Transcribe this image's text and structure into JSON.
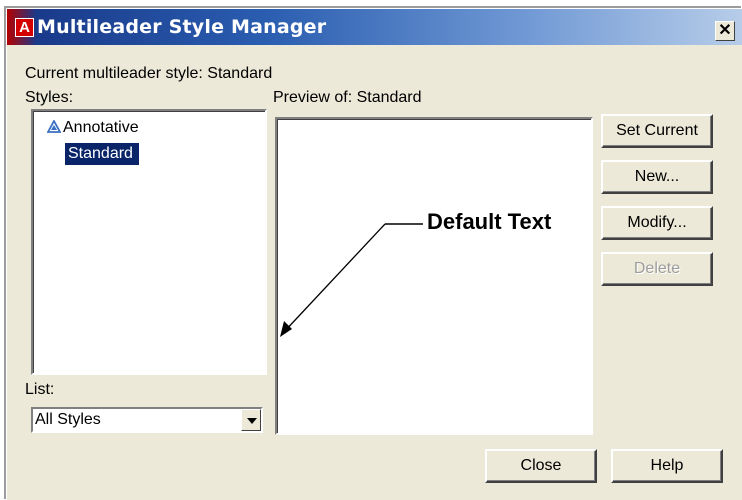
{
  "window": {
    "title": "Multileader Style Manager",
    "app_icon_letter": "A",
    "close_glyph": "✕"
  },
  "current_style": {
    "text": "Current multileader style: Standard"
  },
  "styles": {
    "label": "Styles:",
    "items": [
      {
        "label": "Annotative",
        "icon": "annotative-icon",
        "selected": false
      },
      {
        "label": "Standard",
        "icon": "",
        "selected": true
      }
    ]
  },
  "list": {
    "label": "List:",
    "selected": "All Styles"
  },
  "preview": {
    "label": "Preview of: Standard",
    "default_text": "Default Text"
  },
  "buttons": {
    "set_current": "Set Current",
    "new": "New...",
    "modify": "Modify...",
    "delete": "Delete",
    "close": "Close",
    "help": "Help"
  },
  "colors": {
    "selection": "#0a246a",
    "dialog_bg": "#ece9d8",
    "annotative_icon": "#3a6fc4"
  }
}
